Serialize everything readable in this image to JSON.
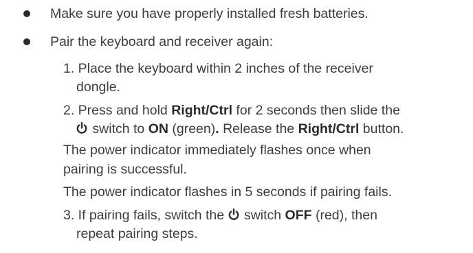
{
  "bullets": [
    {
      "text": "Make sure you have properly installed fresh batteries."
    },
    {
      "text": "Pair the keyboard and receiver again:"
    }
  ],
  "steps": {
    "s1_line1": "1. Place the keyboard within 2 inches of the receiver",
    "s1_line2": "dongle.",
    "s2_a": "2. Press and hold ",
    "s2_b": "Right/Ctrl",
    "s2_c": " for 2 seconds then slide the",
    "s2_d": " switch to ",
    "s2_e": "ON",
    "s2_f": " (green)",
    "s2_g": ".",
    "s2_h": " Release the ",
    "s2_i": "Right/Ctrl",
    "s2_j": " button.",
    "p1_line1": "The power indicator immediately flashes once when",
    "p1_line2": "pairing is successful.",
    "p2": "The power indicator flashes in 5 seconds if pairing fails.",
    "s3_a": "3. If pairing fails, switch the ",
    "s3_b": " switch ",
    "s3_c": "OFF",
    "s3_d": " (red), then",
    "s3_line2": "repeat pairing steps."
  },
  "icons": {
    "power": "power-icon"
  }
}
